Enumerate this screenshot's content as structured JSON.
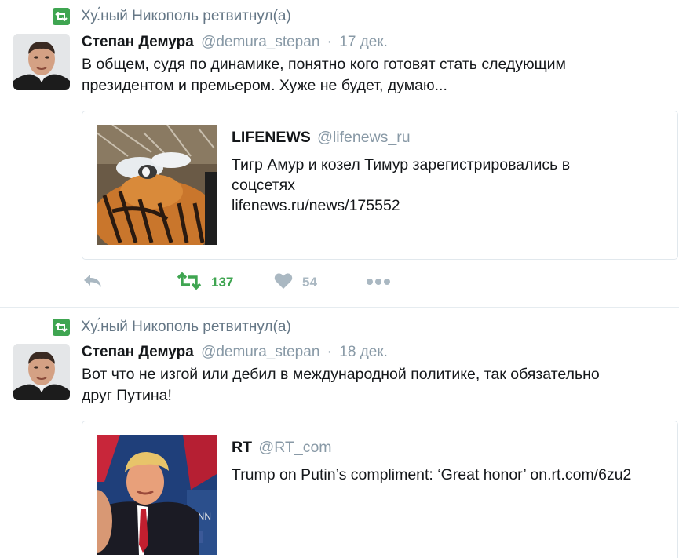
{
  "colors": {
    "retweet_green": "#3fa551",
    "muted": "#8899a6",
    "text": "#14171a",
    "border": "#e1e8ed"
  },
  "tweets": [
    {
      "retweeted_by": "Ху.́ный Никополь ретвитнул(а)",
      "author_name": "Степан Демура",
      "author_handle": "@demura_stepan",
      "separator": "·",
      "time": "17 дек.",
      "text_lines": [
        "В общем, судя по динамике, понятно кого готовят стать следующим",
        "президентом и премьером. Хуже не будет, думаю..."
      ],
      "quote": {
        "name": "LIFENEWS",
        "handle": "@lifenews_ru",
        "text_lines": [
          "Тигр Амур и козел Тимур зарегистрировались в",
          "соцсетях",
          "lifenews.ru/news/175552"
        ],
        "image": "tiger-and-goat-photo"
      },
      "actions": {
        "reply_icon": "reply-icon",
        "retweet_icon": "retweet-icon",
        "retweets": "137",
        "like_icon": "heart-icon",
        "likes": "54",
        "more_icon": "more-icon"
      }
    },
    {
      "retweeted_by": "Ху.́ный Никополь ретвитнул(а)",
      "author_name": "Степан Демура",
      "author_handle": "@demura_stepan",
      "separator": "·",
      "time": "18 дек.",
      "text_lines": [
        "Вот что не изгой или дебил в международной политике, так обязательно",
        "друг Путина!"
      ],
      "quote": {
        "name": "RT",
        "handle": "@RT_com",
        "text_lines": [
          "Trump on Putin’s compliment: ‘Great honor’ on.rt.com/6zu2"
        ],
        "image": "trump-debate-photo",
        "image_caption": "CNN"
      }
    }
  ]
}
